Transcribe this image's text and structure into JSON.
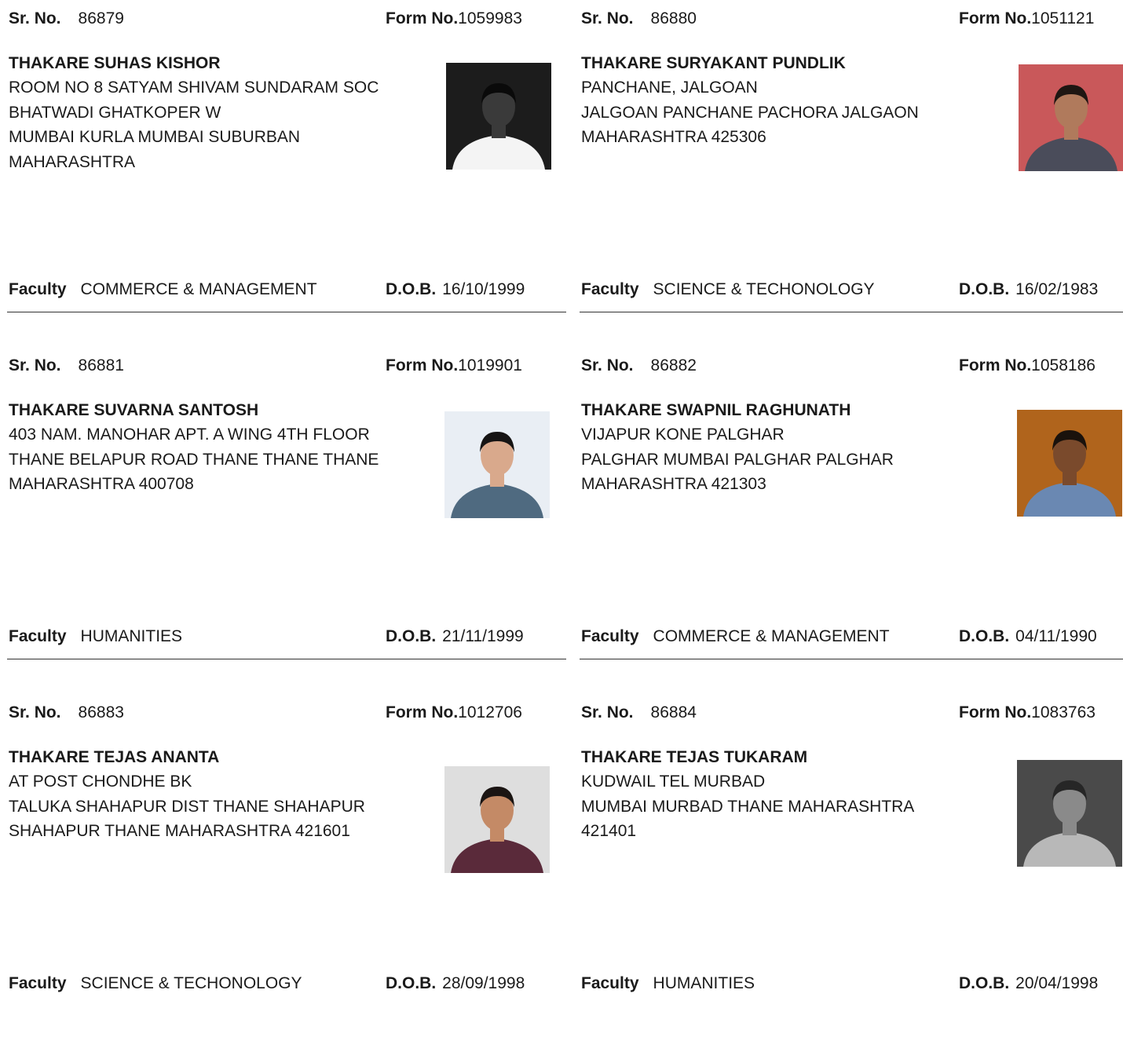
{
  "labels": {
    "sr_no": "Sr. No.",
    "form_no": "Form No.",
    "faculty": "Faculty",
    "dob": "D.O.B."
  },
  "records": [
    {
      "sr_no": "86879",
      "form_no": "1059983",
      "name": "THAKARE SUHAS KISHOR",
      "address": "ROOM NO 8 SATYAM SHIVAM SUNDARAM SOC\nBHATWADI GHATKOPER W\n MUMBAI KURLA MUMBAI SUBURBAN\nMAHARASHTRA",
      "faculty": "COMMERCE & MANAGEMENT",
      "dob": "16/10/1999",
      "photo": {
        "bg": "#1c1c1c",
        "skin": "#3a3a3a",
        "shirt": "#f4f4f4",
        "hair": "#0a0a0a"
      }
    },
    {
      "sr_no": "86880",
      "form_no": "1051121",
      "name": "THAKARE SURYAKANT PUNDLIK",
      "address": "PANCHANE, JALGOAN\nJALGOAN PANCHANE PACHORA JALGAON\nMAHARASHTRA 425306",
      "faculty": "SCIENCE & TECHONOLOGY",
      "dob": "16/02/1983",
      "photo": {
        "bg": "#c9585a",
        "skin": "#b07a5c",
        "shirt": "#4a4c5a",
        "hair": "#1e1612"
      }
    },
    {
      "sr_no": "86881",
      "form_no": "1019901",
      "name": "THAKARE SUVARNA SANTOSH",
      "address": "403 NAM. MANOHAR APT. A WING 4TH FLOOR\nTHANE BELAPUR ROAD THANE THANE THANE\nMAHARASHTRA 400708",
      "faculty": "HUMANITIES",
      "dob": "21/11/1999",
      "photo": {
        "bg": "#e9eef4",
        "skin": "#d9a98c",
        "shirt": "#4f6a80",
        "hair": "#161414"
      }
    },
    {
      "sr_no": "86882",
      "form_no": "1058186",
      "name": "THAKARE SWAPNIL RAGHUNATH",
      "address": "VIJAPUR KONE PALGHAR\nPALGHAR MUMBAI PALGHAR PALGHAR\nMAHARASHTRA 421303",
      "faculty": "COMMERCE & MANAGEMENT",
      "dob": "04/11/1990",
      "photo": {
        "bg": "#b0641c",
        "skin": "#7a4a2c",
        "shirt": "#6a88b2",
        "hair": "#1a120c"
      }
    },
    {
      "sr_no": "86883",
      "form_no": "1012706",
      "name": "THAKARE TEJAS ANANTA",
      "address": "AT POST CHONDHE BK\nTALUKA SHAHAPUR  DIST THANE SHAHAPUR\nSHAHAPUR THANE MAHARASHTRA 421601",
      "faculty": "SCIENCE & TECHONOLOGY",
      "dob": "28/09/1998",
      "photo": {
        "bg": "#dedede",
        "skin": "#c48a66",
        "shirt": "#5a2a3a",
        "hair": "#1a1412"
      }
    },
    {
      "sr_no": "86884",
      "form_no": "1083763",
      "name": "THAKARE TEJAS TUKARAM",
      "address": "KUDWAIL TEL MURBAD\n MUMBAI MURBAD THANE MAHARASHTRA\n421401",
      "faculty": "HUMANITIES",
      "dob": "20/04/1998",
      "photo": {
        "bg": "#4a4a4a",
        "skin": "#8a8a8a",
        "shirt": "#b8b8b8",
        "hair": "#262626"
      }
    }
  ]
}
